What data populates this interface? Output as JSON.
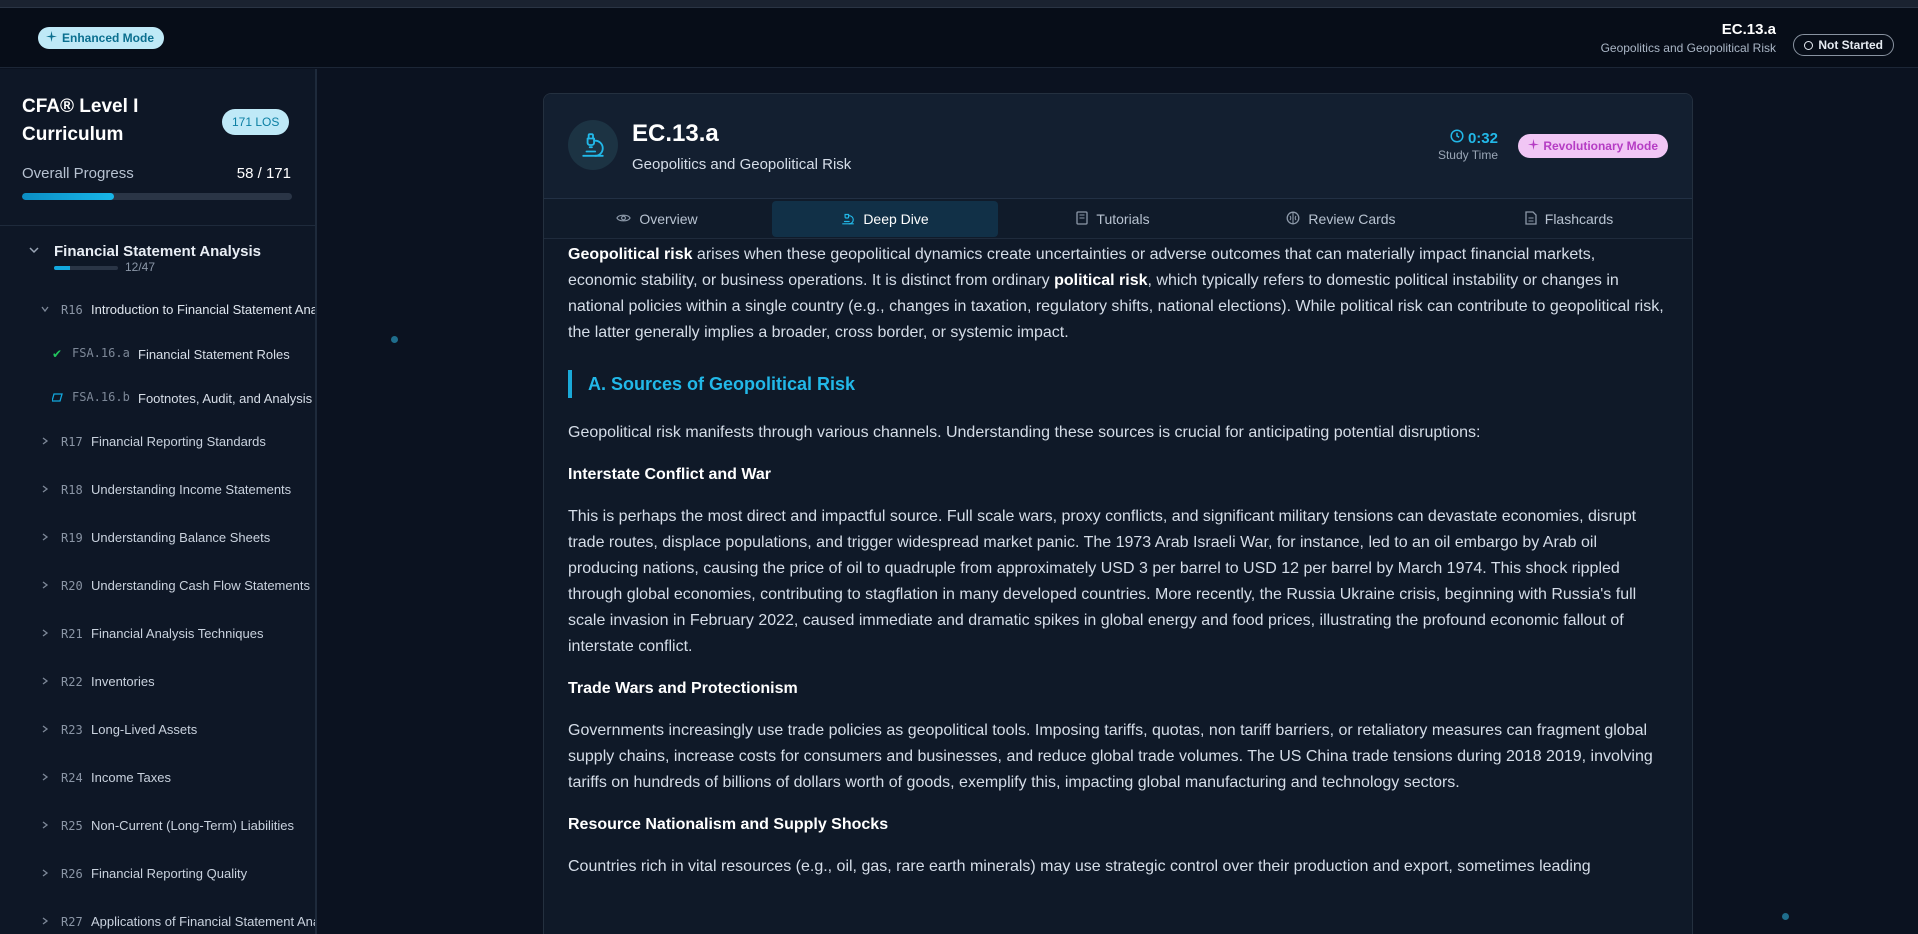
{
  "header": {
    "mode_badge": "Enhanced Mode",
    "los_code": "EC.13.a",
    "los_title": "Geopolitics and Geopolitical Risk",
    "status": "Not Started"
  },
  "sidebar": {
    "title": "CFA® Level I Curriculum",
    "los_total_badge": "171 LOS",
    "progress_label": "Overall Progress",
    "progress_count": "58 / 171",
    "progress_fraction": 0.339,
    "section": {
      "title": "Financial Statement Analysis",
      "count": "12/47"
    },
    "open_reading": {
      "code": "R16",
      "name": "Introduction to Financial Statement Analysis"
    },
    "los_items": [
      {
        "code": "FSA.16.a",
        "name": "Financial Statement Roles",
        "status": "done"
      },
      {
        "code": "FSA.16.b",
        "name": "Footnotes, Audit, and Analysis",
        "status": "partial"
      }
    ],
    "readings": [
      {
        "code": "R17",
        "name": "Financial Reporting Standards"
      },
      {
        "code": "R18",
        "name": "Understanding Income Statements"
      },
      {
        "code": "R19",
        "name": "Understanding Balance Sheets"
      },
      {
        "code": "R20",
        "name": "Understanding Cash Flow Statements"
      },
      {
        "code": "R21",
        "name": "Financial Analysis Techniques"
      },
      {
        "code": "R22",
        "name": "Inventories"
      },
      {
        "code": "R23",
        "name": "Long-Lived Assets"
      },
      {
        "code": "R24",
        "name": "Income Taxes"
      },
      {
        "code": "R25",
        "name": "Non-Current (Long-Term) Liabilities"
      },
      {
        "code": "R26",
        "name": "Financial Reporting Quality"
      },
      {
        "code": "R27",
        "name": "Applications of Financial Statement Analysis"
      }
    ]
  },
  "card": {
    "code": "EC.13.a",
    "subtitle": "Geopolitics and Geopolitical Risk",
    "study_time": "0:32",
    "study_label": "Study Time",
    "mode_badge": "Revolutionary Mode",
    "tabs": [
      {
        "label": "Overview",
        "icon": "eye-icon"
      },
      {
        "label": "Deep Dive",
        "icon": "microscope-icon"
      },
      {
        "label": "Tutorials",
        "icon": "book-icon"
      },
      {
        "label": "Review Cards",
        "icon": "brain-icon"
      },
      {
        "label": "Flashcards",
        "icon": "document-icon"
      }
    ]
  },
  "content": {
    "intro_term": "Geopolitical risk",
    "intro_text1": " arises when these geopolitical dynamics create uncertainties or adverse outcomes that can materially impact financial markets, economic stability, or business operations. It is distinct from ordinary ",
    "intro_term2": "political risk",
    "intro_text2": ", which typically refers to domestic political instability or changes in national policies within a single country (e.g., changes in taxation, regulatory shifts, national elections). While political risk can contribute to geopolitical risk, the latter generally implies a broader, cross border, or systemic impact.",
    "section_heading": "A. Sources of Geopolitical Risk",
    "section_intro": "Geopolitical risk manifests through various channels. Understanding these sources is crucial for anticipating potential disruptions:",
    "sub1_title": "Interstate Conflict and War",
    "sub1_text": "This is perhaps the most direct and impactful source. Full scale wars, proxy conflicts, and significant military tensions can devastate economies, disrupt trade routes, displace populations, and trigger widespread market panic. The 1973 Arab Israeli War, for instance, led to an oil embargo by Arab oil producing nations, causing the price of oil to quadruple from approximately USD 3 per barrel to USD 12 per barrel by March 1974. This shock rippled through global economies, contributing to stagflation in many developed countries. More recently, the Russia Ukraine crisis, beginning with Russia's full scale invasion in February 2022, caused immediate and dramatic spikes in global energy and food prices, illustrating the profound economic fallout of interstate conflict.",
    "sub2_title": "Trade Wars and Protectionism",
    "sub2_text": "Governments increasingly use trade policies as geopolitical tools. Imposing tariffs, quotas, non tariff barriers, or retaliatory measures can fragment global supply chains, increase costs for consumers and businesses, and reduce global trade volumes. The US China trade tensions during 2018 2019, involving tariffs on hundreds of billions of dollars worth of goods, exemplify this, impacting global manufacturing and technology sectors.",
    "sub3_title": "Resource Nationalism and Supply Shocks",
    "sub3_text": "Countries rich in vital resources (e.g., oil, gas, rare earth minerals) may use strategic control over their production and export, sometimes leading"
  }
}
